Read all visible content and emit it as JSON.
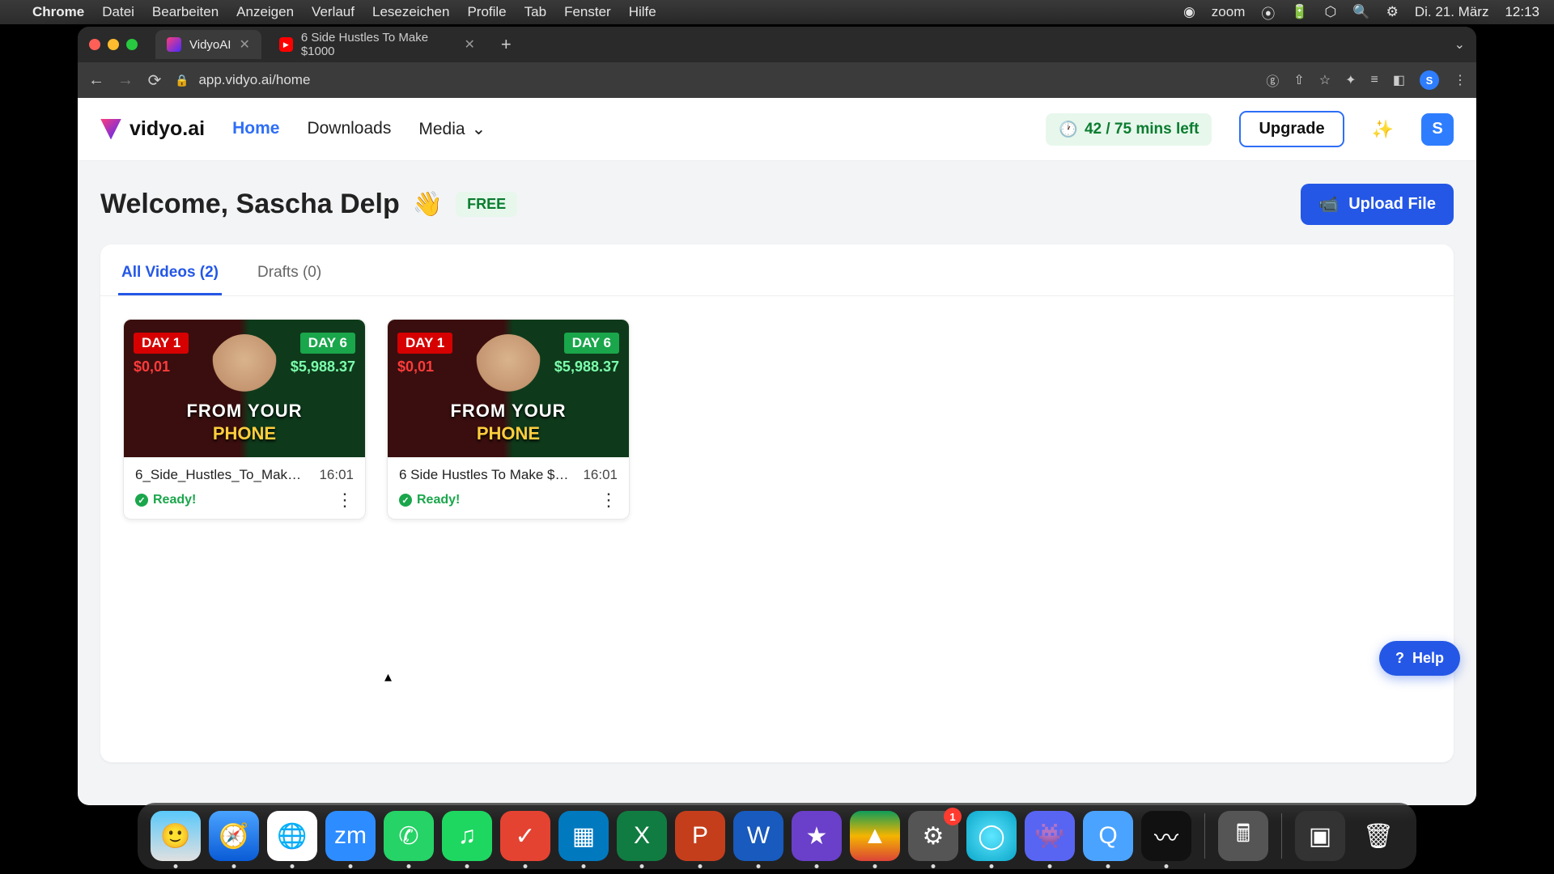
{
  "menubar": {
    "app": "Chrome",
    "items": [
      "Datei",
      "Bearbeiten",
      "Anzeigen",
      "Verlauf",
      "Lesezeichen",
      "Profile",
      "Tab",
      "Fenster",
      "Hilfe"
    ],
    "right": {
      "zoom": "zoom",
      "date": "Di. 21. März",
      "time": "12:13"
    }
  },
  "browser": {
    "tabs": [
      {
        "title": "VidyoAI",
        "active": true
      },
      {
        "title": "6 Side Hustles To Make $1000",
        "active": false
      }
    ],
    "url": "app.vidyo.ai/home",
    "avatar": "S"
  },
  "app": {
    "brand": "vidyo.ai",
    "nav": {
      "home": "Home",
      "downloads": "Downloads",
      "media": "Media"
    },
    "time_left": "42 / 75 mins left",
    "upgrade": "Upgrade",
    "avatar": "S"
  },
  "page": {
    "welcome": "Welcome, Sascha Delp",
    "badge": "FREE",
    "upload": "Upload File",
    "tabs": {
      "all": "All Videos (2)",
      "drafts": "Drafts (0)"
    },
    "videos": [
      {
        "title": "6_Side_Hustles_To_Make_1...",
        "dur": "16:01",
        "status": "Ready!",
        "thumb": {
          "day1": "DAY 1",
          "day6": "DAY 6",
          "amt1": "$0,01",
          "amt2": "$5,988.37",
          "line1": "FROM YOUR",
          "line2": "PHONE"
        }
      },
      {
        "title": "6 Side Hustles To Make $1...",
        "dur": "16:01",
        "status": "Ready!",
        "thumb": {
          "day1": "DAY 1",
          "day6": "DAY 6",
          "amt1": "$0,01",
          "amt2": "$5,988.37",
          "line1": "FROM YOUR",
          "line2": "PHONE"
        }
      }
    ],
    "help": "Help"
  },
  "dock": {
    "settings_badge": "1"
  }
}
